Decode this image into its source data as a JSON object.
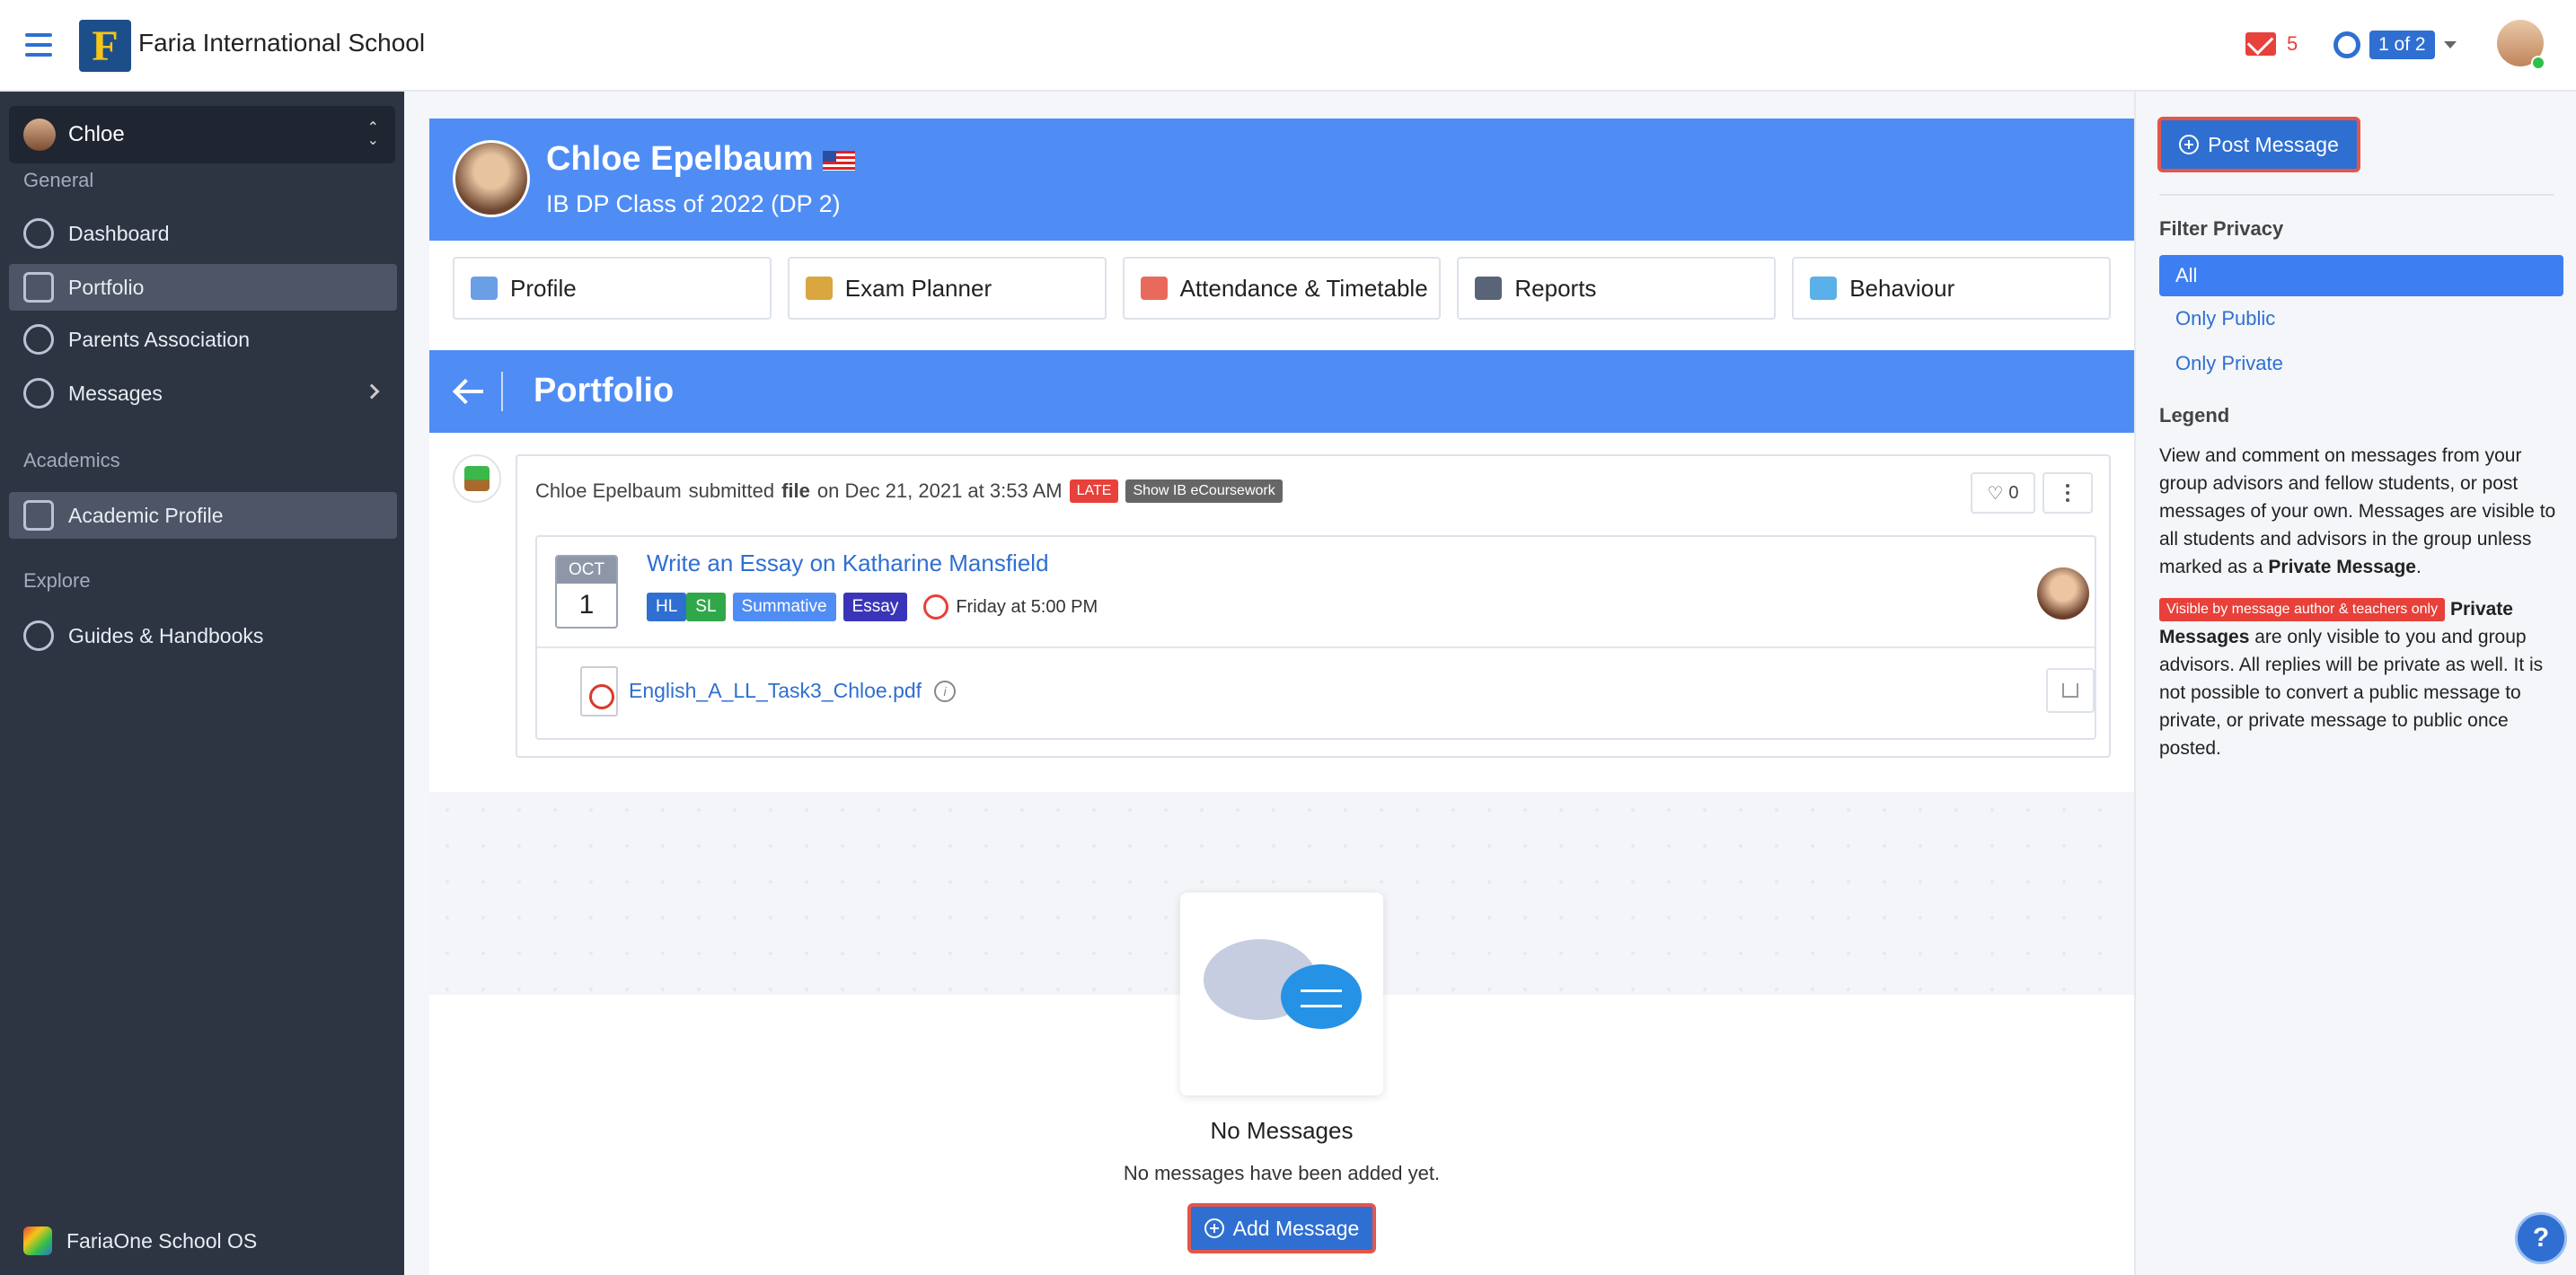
{
  "header": {
    "school_name": "Faria International School",
    "logo_letter": "F",
    "mail_count": "5",
    "pager": "1 of 2"
  },
  "sidebar": {
    "student": "Chloe",
    "sections": {
      "general": "General",
      "academics": "Academics",
      "explore": "Explore"
    },
    "items": [
      {
        "label": "Dashboard",
        "icon": "dashboard-icon"
      },
      {
        "label": "Portfolio",
        "icon": "briefcase-icon",
        "active": true
      },
      {
        "label": "Parents Association",
        "icon": "people-icon"
      },
      {
        "label": "Messages",
        "icon": "chat-icon"
      },
      {
        "label": "Academic Profile",
        "icon": "document-icon",
        "active": true
      },
      {
        "label": "Guides & Handbooks",
        "icon": "guides-icon"
      }
    ],
    "footer": "FariaOne School OS"
  },
  "profile": {
    "name": "Chloe Epelbaum",
    "class": "IB DP Class of 2022 (DP 2)",
    "tabs": [
      "Profile",
      "Exam Planner",
      "Attendance & Timetable",
      "Reports",
      "Behaviour"
    ]
  },
  "portfolio": {
    "title": "Portfolio",
    "entry": {
      "author": "Chloe Epelbaum",
      "action": "submitted",
      "type": "file",
      "date_text": "on Dec 21, 2021 at 3:53 AM",
      "late_badge": "LATE",
      "ib_badge": "Show IB eCoursework",
      "likes": "0",
      "task": {
        "month": "OCT",
        "day": "1",
        "title": "Write an Essay on Katharine Mansfield",
        "tags": [
          "HL",
          "SL",
          "Summative",
          "Essay"
        ],
        "due": "Friday at 5:00 PM"
      },
      "file_name": "English_A_LL_Task3_Chloe.pdf"
    },
    "empty": {
      "title": "No Messages",
      "subtitle": "No messages have been added yet.",
      "button": "Add Message"
    }
  },
  "right_panel": {
    "post_button": "Post Message",
    "filter_heading": "Filter Privacy",
    "filters": [
      "All",
      "Only Public",
      "Only Private"
    ],
    "legend_heading": "Legend",
    "legend_p1_a": "View and comment on messages from your group advisors and fellow students, or post messages of your own. Messages are visible to all students and advisors in the group unless marked as a ",
    "legend_p1_b": "Private Message",
    "legend_p1_c": ".",
    "private_badge": "Visible by message author & teachers only",
    "legend_p2_a": "Private Messages",
    "legend_p2_b": " are only visible to you and group advisors. All replies will be private as well. It is not possible to convert a public message to private, or private message to public once posted."
  },
  "colors": {
    "brand_blue": "#4f8df5",
    "link_blue": "#2f6fd1",
    "sidebar_bg": "#2d3442",
    "late_red": "#e8403a",
    "highlight_outline": "#e2574c"
  }
}
